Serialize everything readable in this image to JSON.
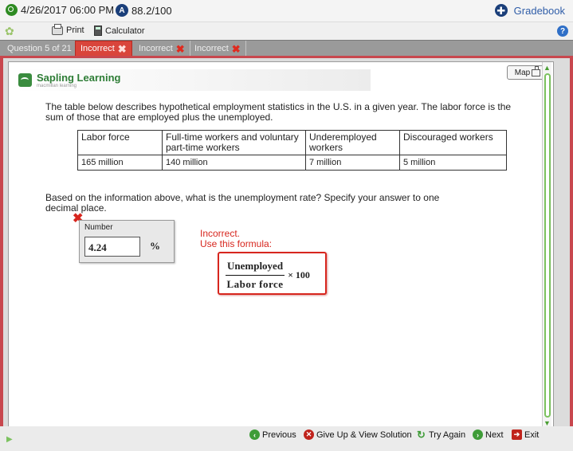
{
  "header": {
    "datetime": "4/26/2017 06:00 PM",
    "score": "88.2/100",
    "gradebook_label": "Gradebook"
  },
  "toolbar": {
    "print_label": "Print",
    "calculator_label": "Calculator",
    "help_label": "?"
  },
  "tabs": [
    {
      "label": "Question 5 of 21"
    },
    {
      "label": "Incorrect",
      "status": "incorrect",
      "active": true
    },
    {
      "label": "Incorrect",
      "status": "incorrect"
    },
    {
      "label": "Incorrect",
      "status": "incorrect"
    }
  ],
  "logo": {
    "name": "Sapling Learning",
    "sub": "macmillan learning"
  },
  "map_label": "Map",
  "question": {
    "text": "The table below describes hypothetical employment statistics in the U.S. in a given year. The labor force is the sum of those that are employed plus the unemployed.",
    "table": {
      "headers": [
        "Labor force",
        "Full-time workers and voluntary part-time workers",
        "Underemployed workers",
        "Discouraged workers"
      ],
      "values": [
        "165 million",
        "140 million",
        "7 million",
        "5 million"
      ]
    },
    "prompt": "Based on the information above, what is the unemployment rate? Specify your answer to one decimal place."
  },
  "answer": {
    "label": "Number",
    "value": "4.24",
    "unit": "%",
    "status": "incorrect"
  },
  "feedback": {
    "line1": "Incorrect.",
    "line2": "Use this formula:",
    "formula_numerator": "Unemployed",
    "formula_denominator": "Labor force",
    "formula_multiplier": "× 100"
  },
  "footer_nav": {
    "previous": "Previous",
    "give_up": "Give Up & View Solution",
    "try_again": "Try Again",
    "next": "Next",
    "exit": "Exit"
  },
  "colors": {
    "accent_red": "#d7261e",
    "frame_red": "#c8474e",
    "sapling_green": "#2e7d36",
    "link_blue": "#2f5da8"
  }
}
